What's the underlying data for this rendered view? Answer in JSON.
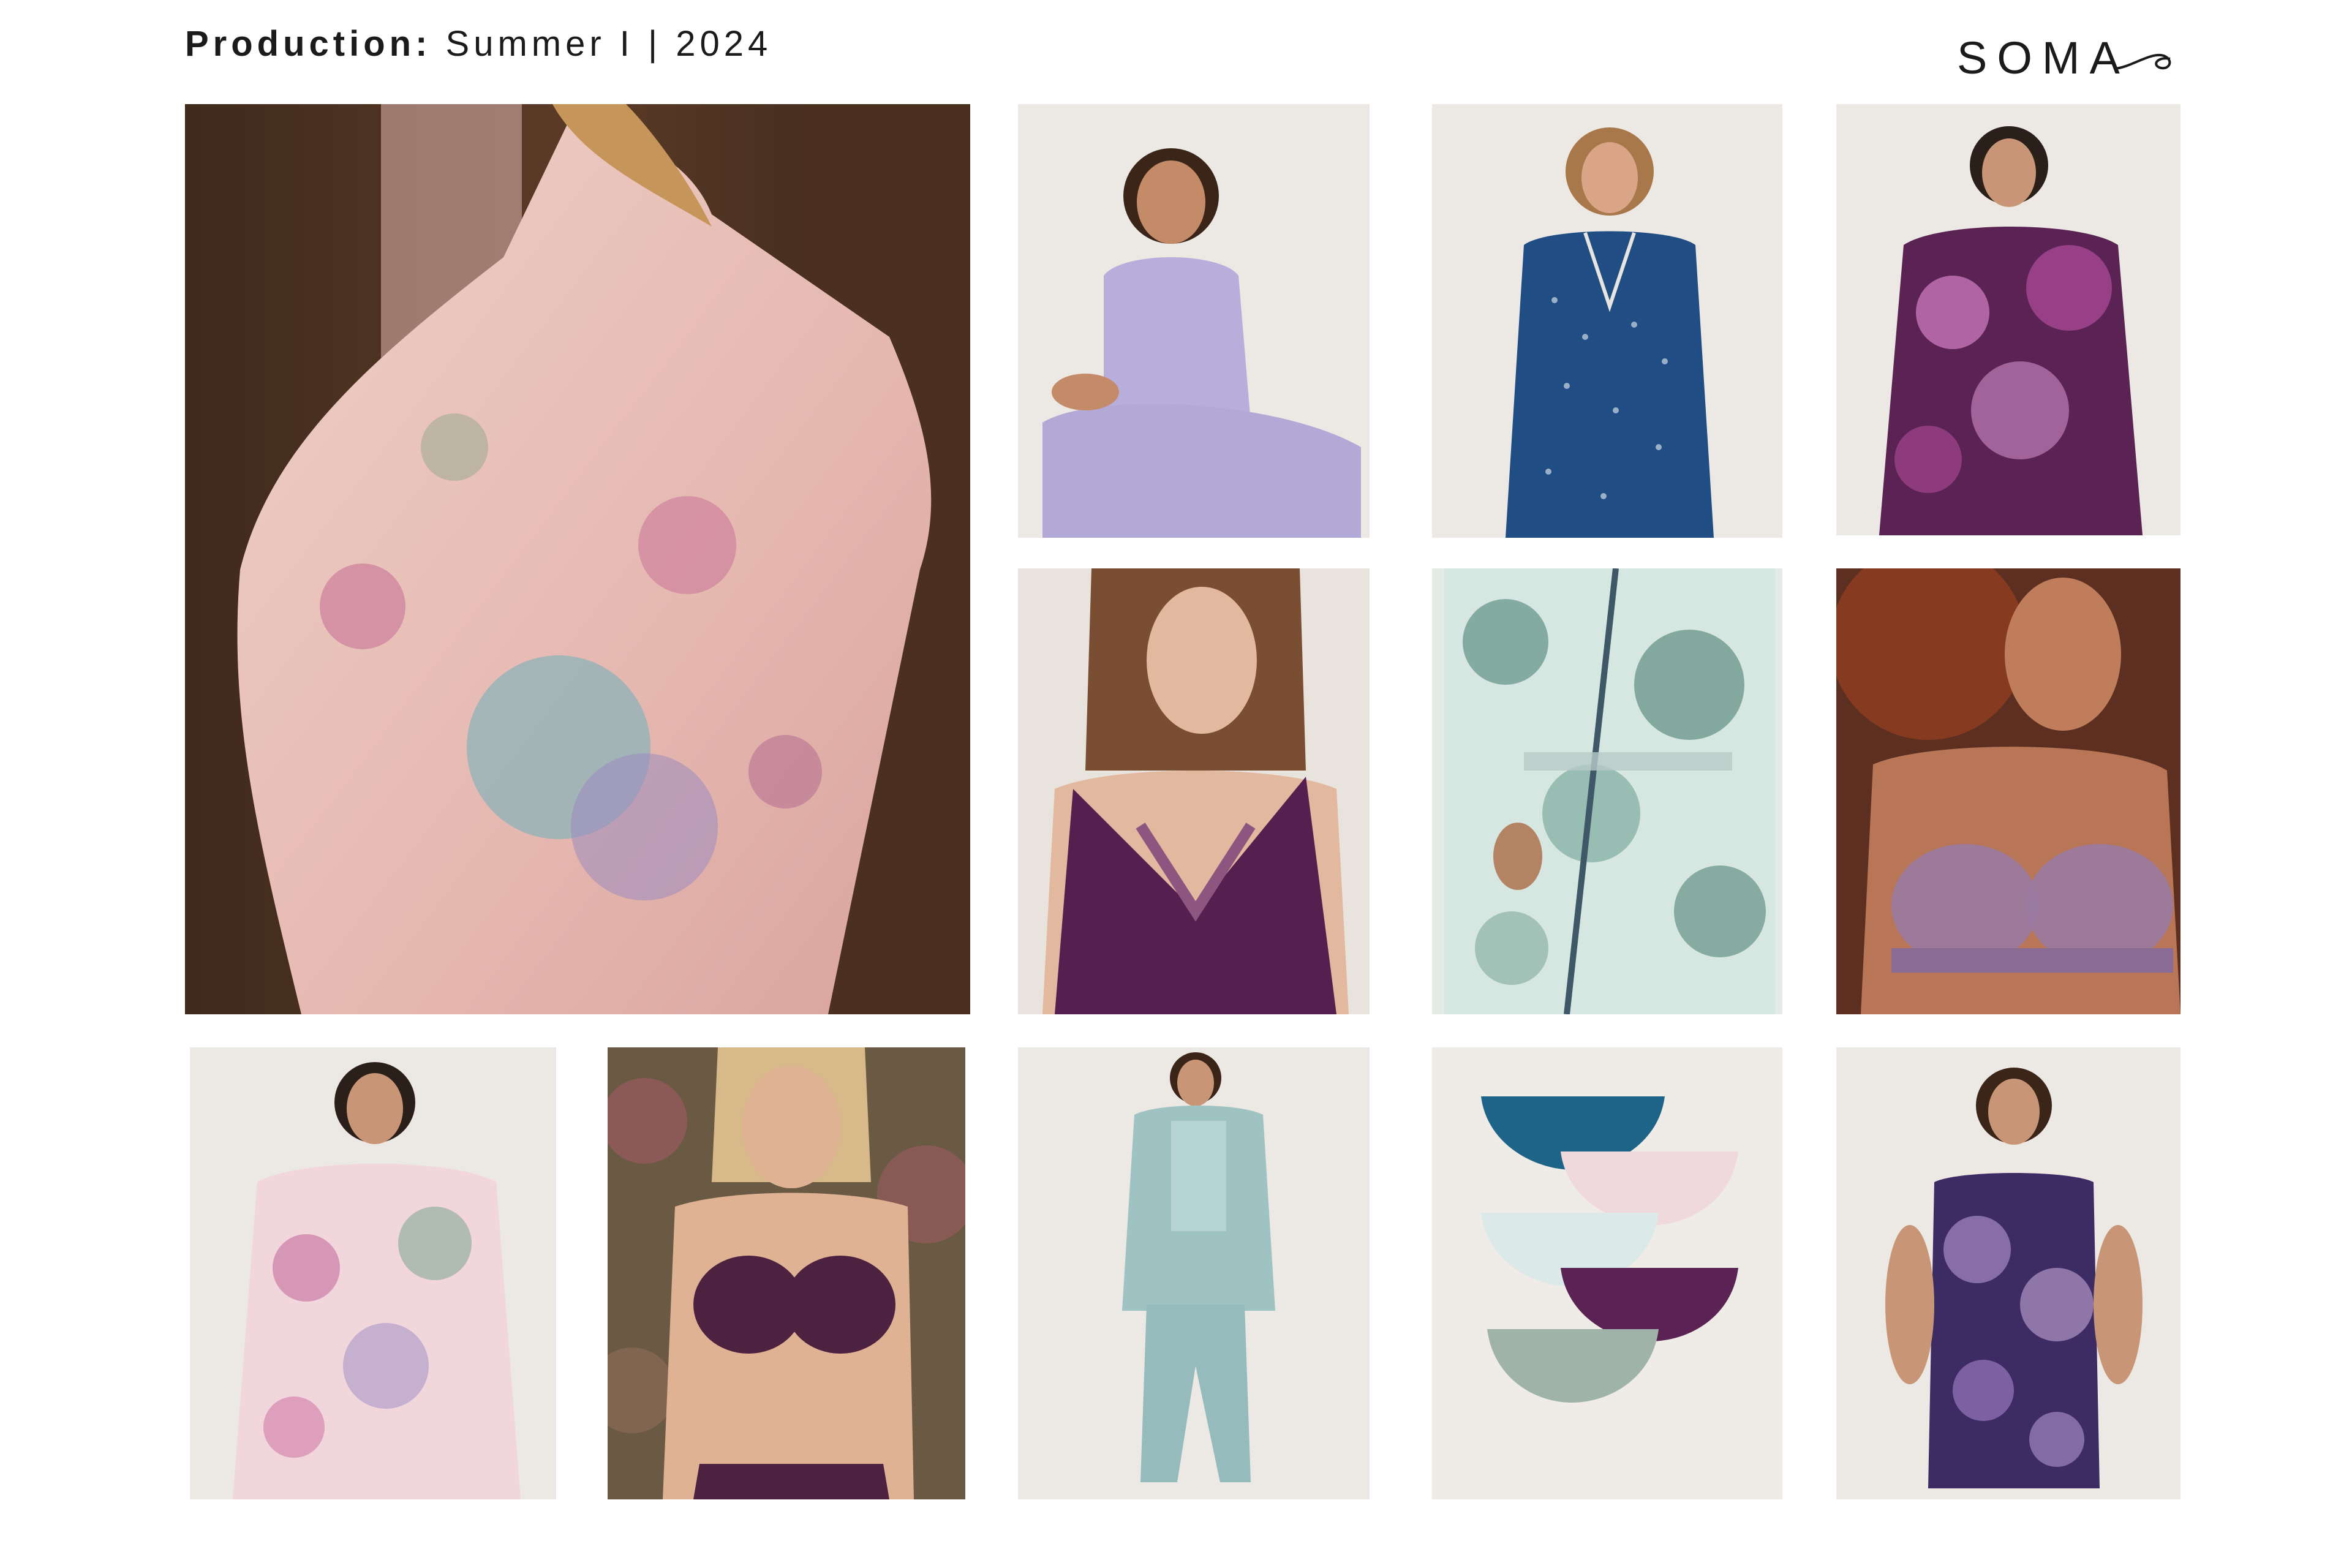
{
  "header": {
    "production_label": "Production:",
    "season": "Summer I | 2024"
  },
  "logo": {
    "text": "SOMA"
  },
  "colors": {
    "background": "#ffffff",
    "text": "#1b1b1b",
    "studio_backdrop": "#ebe5de",
    "pink_satin": "#e8bfb7",
    "lavender": "#b8aedb",
    "navy": "#1f4d84",
    "plum": "#5a2353",
    "teal_satin": "#9fc2c3"
  },
  "photos": [
    {
      "subject": "pink floral satin robe, back view"
    },
    {
      "subject": "lavender tank and pant set"
    },
    {
      "subject": "navy dot pajama set with piping"
    },
    {
      "subject": "purple floral pajama shirt"
    },
    {
      "subject": "plum lace-trim chemise"
    },
    {
      "subject": "toile print wrap robe"
    },
    {
      "subject": "lavender lace bra"
    },
    {
      "subject": "pink floral pajama shirt"
    },
    {
      "subject": "plum lace bra and panty"
    },
    {
      "subject": "teal satin robe and pajama set"
    },
    {
      "subject": "multicolor panty stack"
    },
    {
      "subject": "navy paisley cami and short set"
    }
  ]
}
